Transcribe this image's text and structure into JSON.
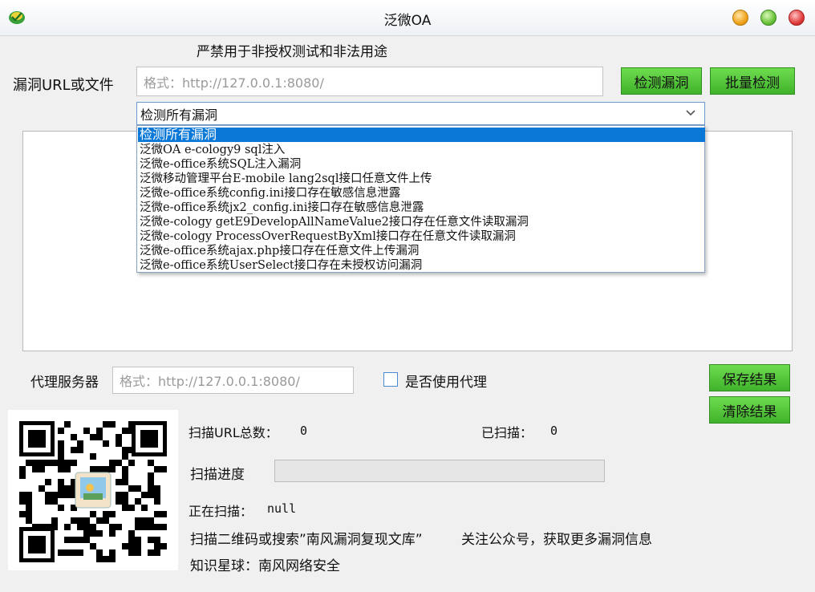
{
  "window": {
    "title": "泛微OA"
  },
  "warning": "严禁用于非授权测试和非法用途",
  "url_label": "漏洞URL或文件",
  "url_input": {
    "placeholder": "格式：http://127.0.0.1:8080/",
    "value": ""
  },
  "buttons": {
    "check": "检测漏洞",
    "batch": "批量检测",
    "save": "保存结果",
    "clear": "清除结果"
  },
  "vuln_select": {
    "selected": "检测所有漏洞",
    "options": [
      "检测所有漏洞",
      "泛微OA e-cology9 sql注入",
      "泛微e-office系统SQL注入漏洞",
      "泛微移动管理平台E-mobile lang2sql接口任意文件上传",
      "泛微e-office系统config.ini接口存在敏感信息泄露",
      "泛微e-office系统jx2_config.ini接口存在敏感信息泄露",
      "泛微e-cology getE9DevelopAllNameValue2接口存在任意文件读取漏洞",
      "泛微e-cology ProcessOverRequestByXml接口存在任意文件读取漏洞",
      "泛微e-office系统ajax.php接口存在任意文件上传漏洞",
      "泛微e-office系统UserSelect接口存在未授权访问漏洞"
    ]
  },
  "proxy": {
    "label": "代理服务器",
    "placeholder": "格式：http://127.0.0.1:8080/",
    "use_label": "是否使用代理",
    "checked": false
  },
  "stats": {
    "total_label": "扫描URL总数：",
    "total_value": "0",
    "scanned_label": "已扫描：",
    "scanned_value": "0",
    "progress_label": "扫描进度",
    "progress": 0,
    "scanning_label": "正在扫描：",
    "scanning_value": "null"
  },
  "footer": {
    "search_text": "扫描二维码或搜索”南风漏洞复现文库”",
    "follow_text": "关注公众号，获取更多漏洞信息",
    "planet_text": "知识星球：南风网络安全"
  },
  "icons": {
    "app": "app-logo-icon",
    "min": "minimize-icon",
    "max": "maximize-icon",
    "close": "close-icon",
    "dropdown": "chevron-down-icon",
    "qr": "qr-code-icon"
  }
}
